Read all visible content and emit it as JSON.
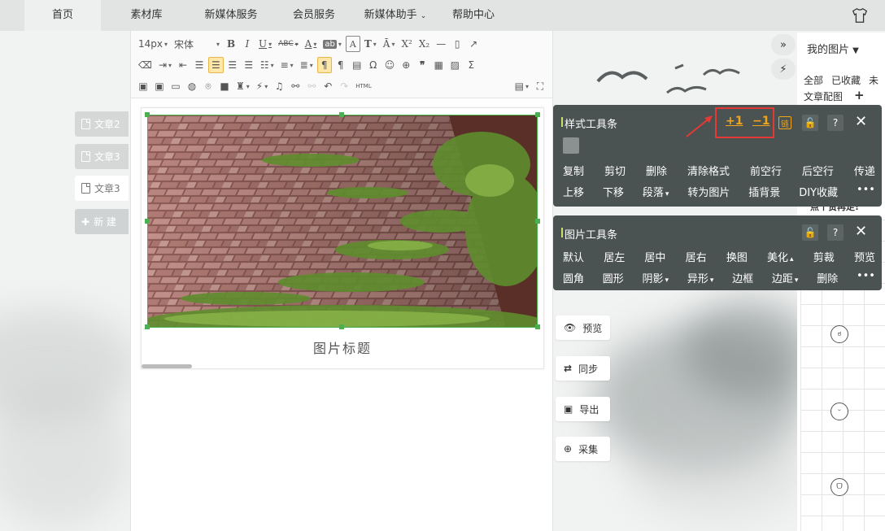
{
  "nav": {
    "items": [
      "首页",
      "素材库",
      "新媒体服务",
      "会员服务",
      "新媒体助手",
      "帮助中心"
    ],
    "active": "首页"
  },
  "article_tabs": [
    "文章2",
    "文章3",
    "文章3"
  ],
  "new_article_label": "新 建",
  "toolbar": {
    "font_size": "14px",
    "font_family": "宋体",
    "html_label": "HTML"
  },
  "image": {
    "caption": "图片标题"
  },
  "style_toolbar": {
    "title": "样式工具条",
    "plus_label": "+1",
    "minus_label": "−1",
    "chain_label": "链",
    "help_label": "?",
    "row1": [
      "复制",
      "剪切",
      "删除",
      "清除格式",
      "前空行",
      "后空行",
      "传递"
    ],
    "row2": [
      "上移",
      "下移",
      "段落",
      "转为图片",
      "插背景",
      "DIY收藏",
      "•••"
    ]
  },
  "image_toolbar": {
    "title": "图片工具条",
    "help_label": "?",
    "row1": [
      "默认",
      "居左",
      "居中",
      "居右",
      "换图",
      "美化",
      "剪裁",
      "预览"
    ],
    "row2": [
      "圆角",
      "圆形",
      "阴影",
      "异形",
      "边框",
      "边距",
      "删除",
      "•••"
    ]
  },
  "side_buttons": [
    {
      "label": "预览",
      "icon": "eye-icon"
    },
    {
      "label": "同步",
      "icon": "sync-icon"
    },
    {
      "label": "导出",
      "icon": "export-icon"
    },
    {
      "label": "采集",
      "icon": "collect-icon"
    }
  ],
  "right_panel": {
    "dropdown_label": "我的图片",
    "filters": [
      "全部",
      "已收藏",
      "未"
    ],
    "section_label": "文章配图",
    "add_label": "+",
    "partial_text": "点个赞再走!"
  },
  "colors": {
    "popup_bg": "#4a5252",
    "accent_orange": "#f2a51a",
    "highlight_red": "#e53935",
    "selection_green": "#4caf50"
  }
}
